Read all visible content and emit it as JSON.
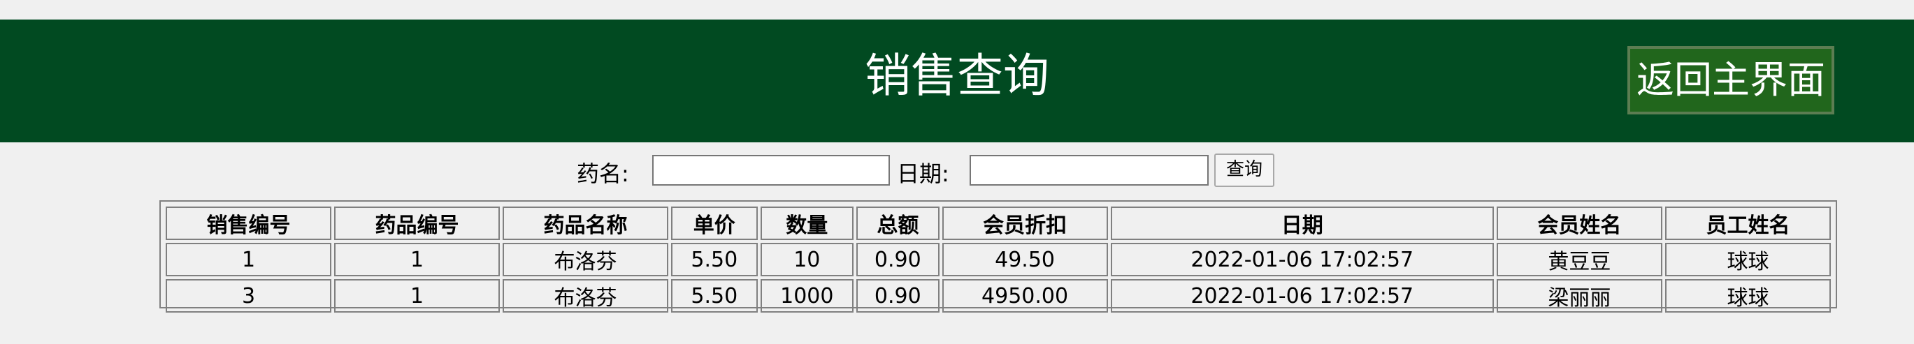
{
  "header": {
    "title": "销售查询",
    "back_button": "返回主界面",
    "colors": {
      "bar": "#014a21",
      "button": "#21661c"
    }
  },
  "search": {
    "drug_label": "药名:",
    "drug_value": "",
    "date_label": "日期:",
    "date_value": "",
    "query_button": "查询"
  },
  "table": {
    "headers": [
      "销售编号",
      "药品编号",
      "药品名称",
      "单价",
      "数量",
      "总额",
      "会员折扣",
      "日期",
      "会员姓名",
      "员工姓名"
    ],
    "rows": [
      [
        "1",
        "1",
        "布洛芬",
        "5.50",
        "10",
        "0.90",
        "49.50",
        "2022-01-06 17:02:57",
        "黄豆豆",
        "球球"
      ],
      [
        "3",
        "1",
        "布洛芬",
        "5.50",
        "1000",
        "0.90",
        "4950.00",
        "2022-01-06 17:02:57",
        "梁丽丽",
        "球球"
      ]
    ]
  }
}
